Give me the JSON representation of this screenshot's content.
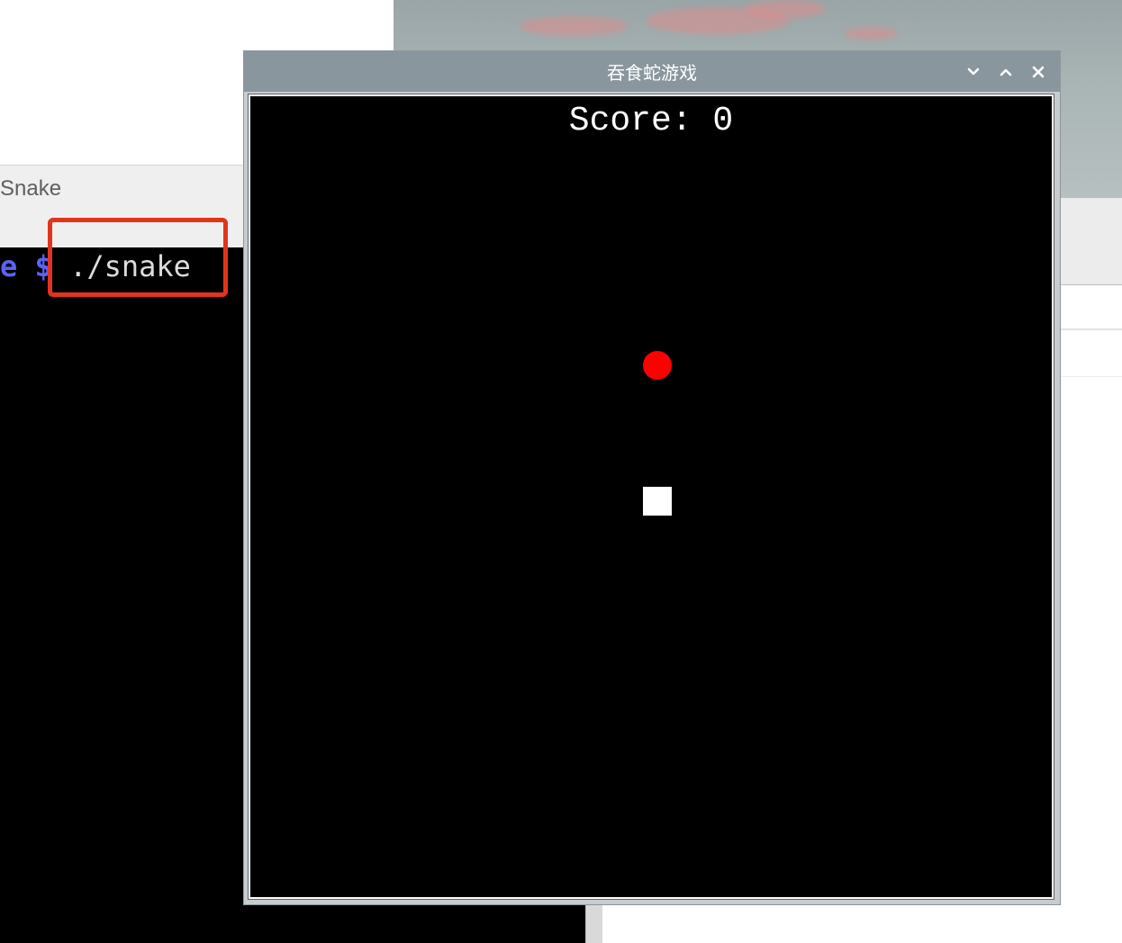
{
  "terminal": {
    "title": "Snake",
    "prompt": "e $",
    "command": " ./snake"
  },
  "game_window": {
    "title": "吞食蛇游戏",
    "controls": {
      "minimize_icon": "chevron-down-icon",
      "maximize_icon": "chevron-up-icon",
      "close_icon": "close-icon"
    },
    "score_label": "Score:",
    "score_value": "0"
  },
  "colors": {
    "food": "#ff0000",
    "snake": "#ffffff",
    "highlight": "#e2341d",
    "prompt": "#5b62f5",
    "titlebar": "#8a969d"
  }
}
